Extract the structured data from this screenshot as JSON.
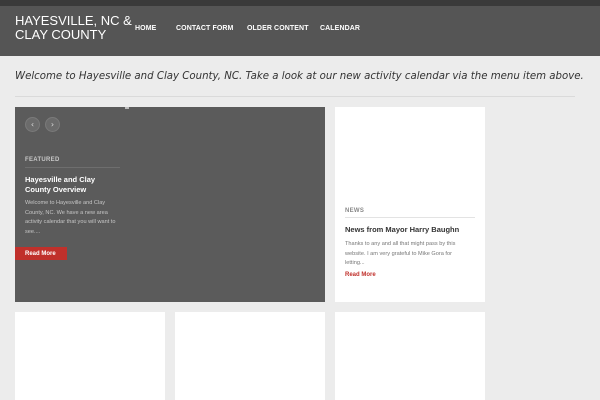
{
  "header": {
    "site_title": "HAYESVILLE, NC & CLAY COUNTY"
  },
  "nav": {
    "items": [
      {
        "label": "HOME"
      },
      {
        "label": "CONTACT FORM"
      },
      {
        "label": "OLDER CONTENT"
      },
      {
        "label": "CALENDAR"
      }
    ]
  },
  "intro": {
    "welcome": "Welcome to Hayesville and Clay County, NC. Take a look at our new activity calendar via the menu item above."
  },
  "featured": {
    "category": "FEATURED",
    "title": "Hayesville and Clay County Overview",
    "excerpt": "Welcome to Hayesville and Clay County, NC. We have a new area activity calendar that you will want to see....",
    "read_more": "Read More",
    "prev_icon": "chevron-left-icon",
    "next_icon": "chevron-right-icon"
  },
  "news_card": {
    "category": "NEWS",
    "title": "News from Mayor Harry Baughn",
    "excerpt": "Thanks to any and all that might pass by this website. I am very grateful to Mike Gora for letting...",
    "read_more": "Read More"
  },
  "colors": {
    "header_bg": "#555555",
    "featured_bg": "#5b5b5b",
    "accent_red": "#c0302b",
    "page_bg": "#ececec"
  }
}
